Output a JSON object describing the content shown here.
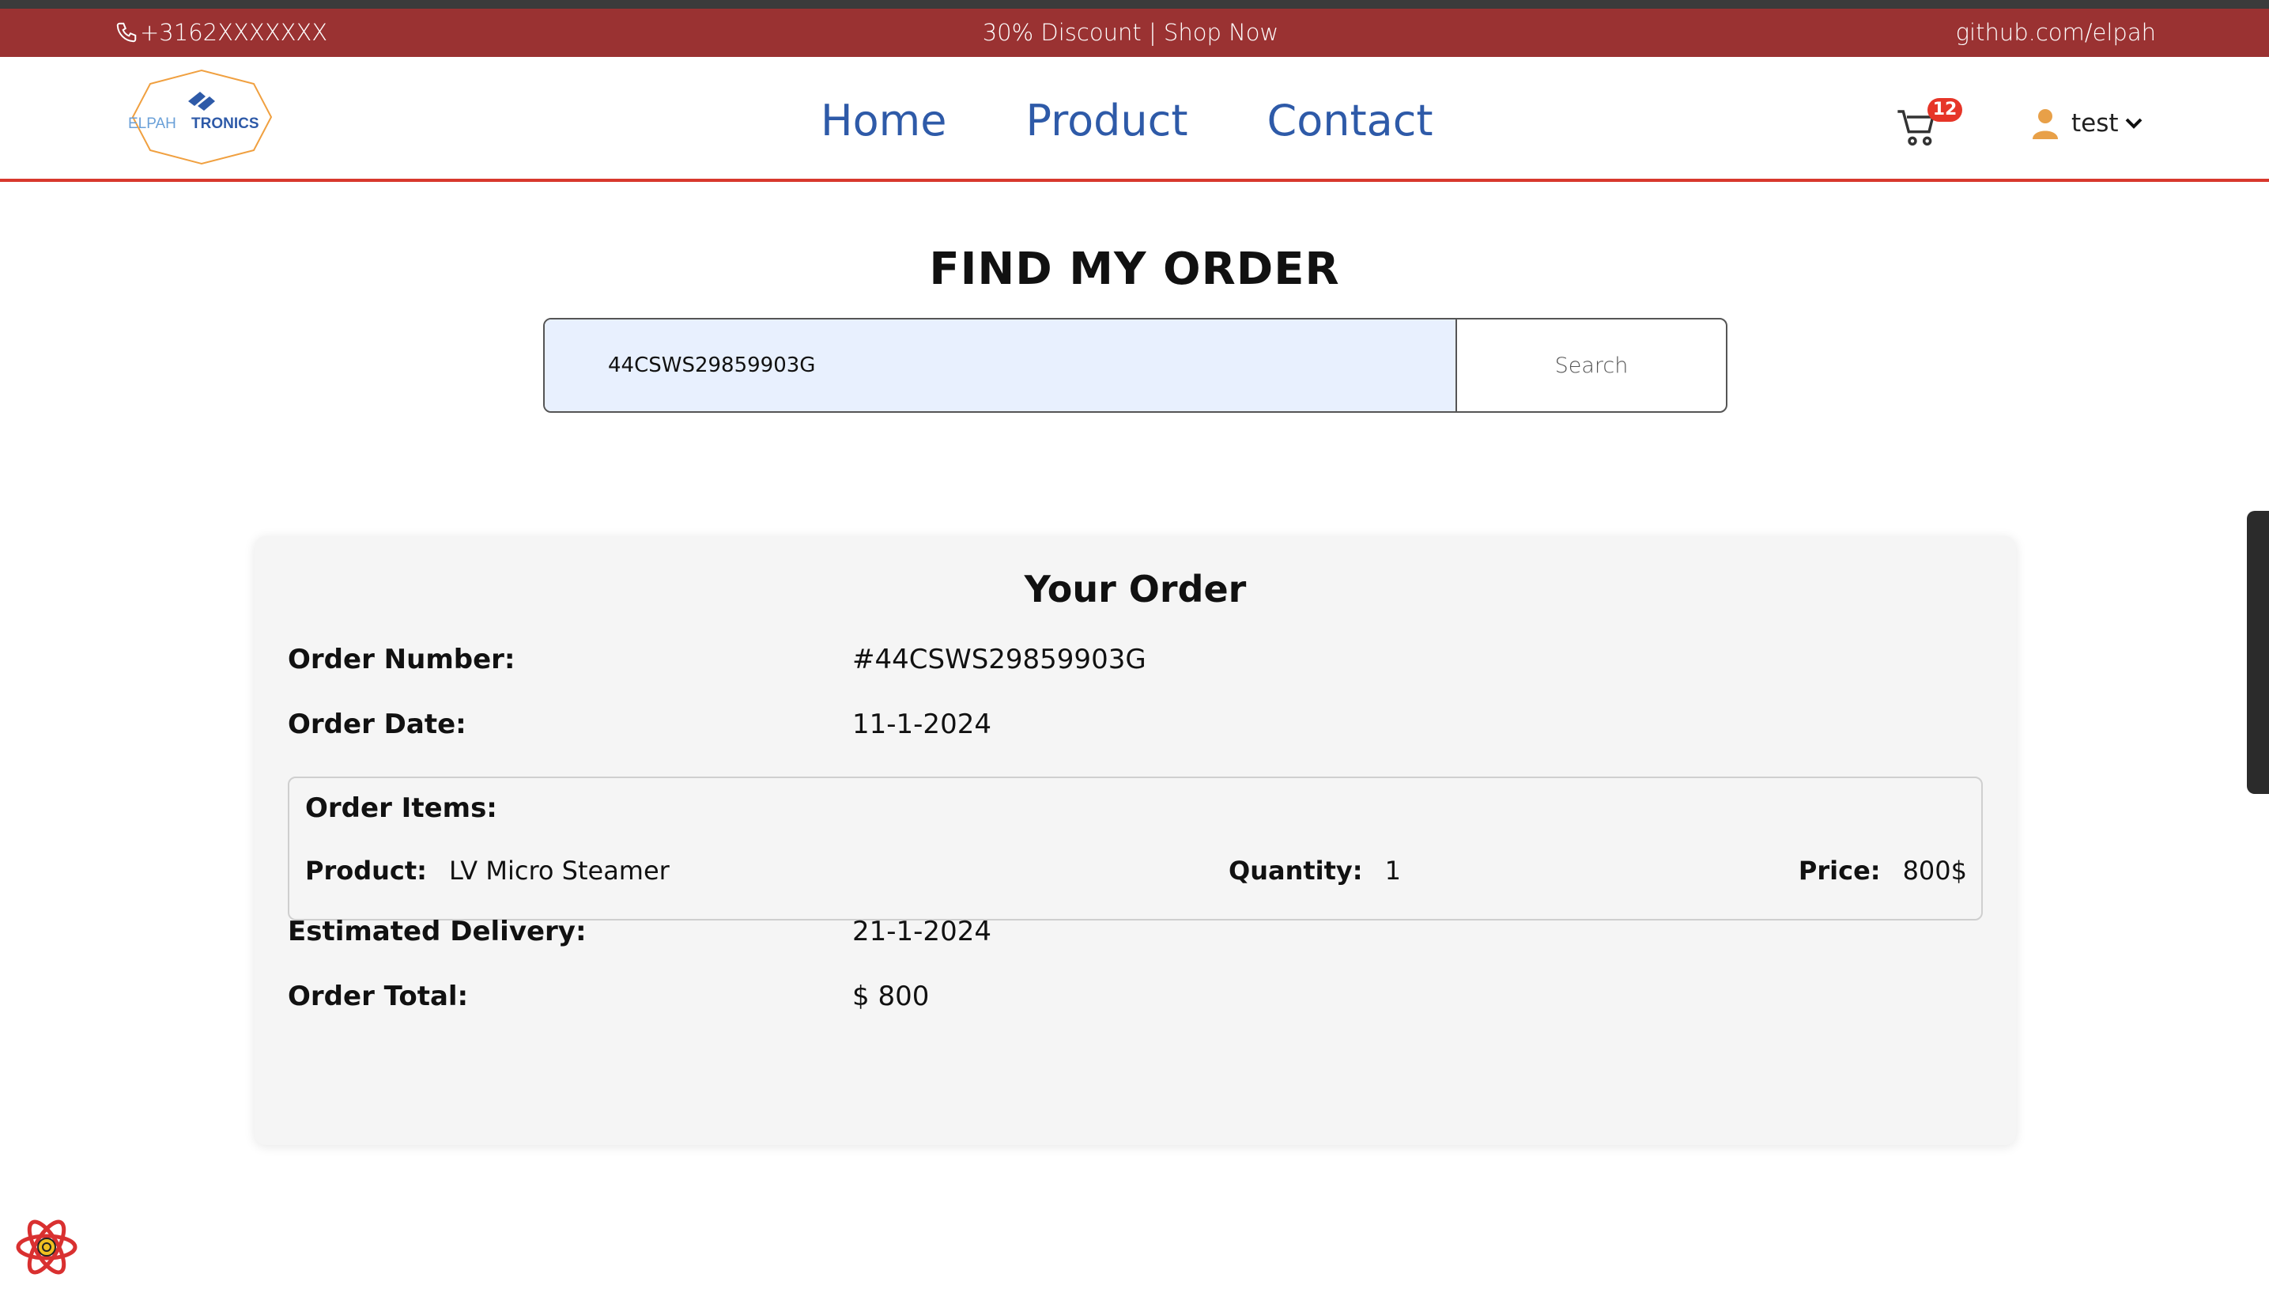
{
  "topbar": {
    "phone": "+3162XXXXXXX",
    "promo": "30% Discount | Shop Now",
    "github": "github.com/elpah"
  },
  "nav": {
    "logo_text_left": "ELPAH",
    "logo_text_right": "TRONICS",
    "links": [
      "Home",
      "Product",
      "Contact"
    ],
    "cart_count": "12",
    "user_name": "test"
  },
  "find": {
    "title": "FIND MY ORDER",
    "search_value": "44CSWS29859903G",
    "search_button": "Search"
  },
  "order": {
    "heading": "Your Order",
    "number_label": "Order Number:",
    "number_value": "#44CSWS29859903G",
    "date_label": "Order Date:",
    "date_value": "11-1-2024",
    "items_heading": "Order Items:",
    "item": {
      "product_label": "Product:",
      "product_value": "LV Micro Steamer",
      "quantity_label": "Quantity:",
      "quantity_value": "1",
      "price_label": "Price:",
      "price_value": "800$"
    },
    "delivery_label": "Estimated Delivery:",
    "delivery_value": "21-1-2024",
    "total_label": "Order Total:",
    "total_value": "$ 800"
  },
  "colors": {
    "topbar": "#9a3232",
    "nav_link": "#2e5aa8",
    "nav_border": "#d8382d",
    "badge": "#e63528",
    "search_input_bg": "#e8f0fe",
    "card_bg": "#f5f5f5"
  }
}
